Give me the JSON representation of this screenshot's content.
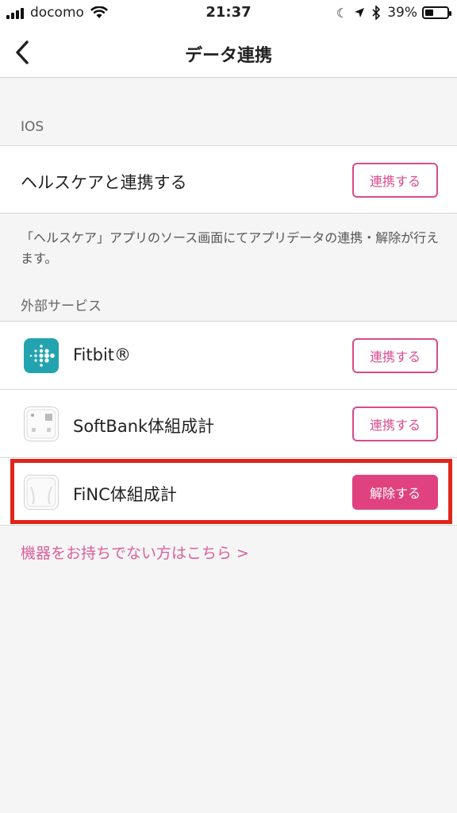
{
  "status_bar": {
    "carrier": "docomo",
    "time": "21:37",
    "battery_percent": "39%",
    "battery_level": 0.39,
    "icons": [
      "signal-icon",
      "wifi-icon",
      "moon-icon",
      "location-arrow-icon",
      "bluetooth-icon",
      "battery-icon"
    ]
  },
  "nav": {
    "title": "データ連携",
    "back_icon": "chevron-left-icon"
  },
  "ios_section": {
    "label": "IOS",
    "healthcare_row": {
      "label": "ヘルスケアと連携する",
      "button": "連携する"
    },
    "note": "「ヘルスケア」アプリのソース画面にてアプリデータの連携・解除が行えます。"
  },
  "external_section": {
    "label": "外部サービス",
    "services": [
      {
        "name": "Fitbit®",
        "icon": "fitbit-icon",
        "button": "連携する",
        "connected": false
      },
      {
        "name": "SoftBank体組成計",
        "icon": "softbank-scale-icon",
        "button": "連携する",
        "connected": false
      },
      {
        "name": "FiNC体組成計",
        "icon": "finc-scale-icon",
        "button": "解除する",
        "connected": true
      }
    ]
  },
  "footer_link": "機器をお持ちでない方はこちら >",
  "colors": {
    "accent": "#d94b8d",
    "accent_filled": "#e0417f",
    "highlight": "#e0251a",
    "fitbit": "#22a4b0",
    "background": "#f5f5f5"
  }
}
